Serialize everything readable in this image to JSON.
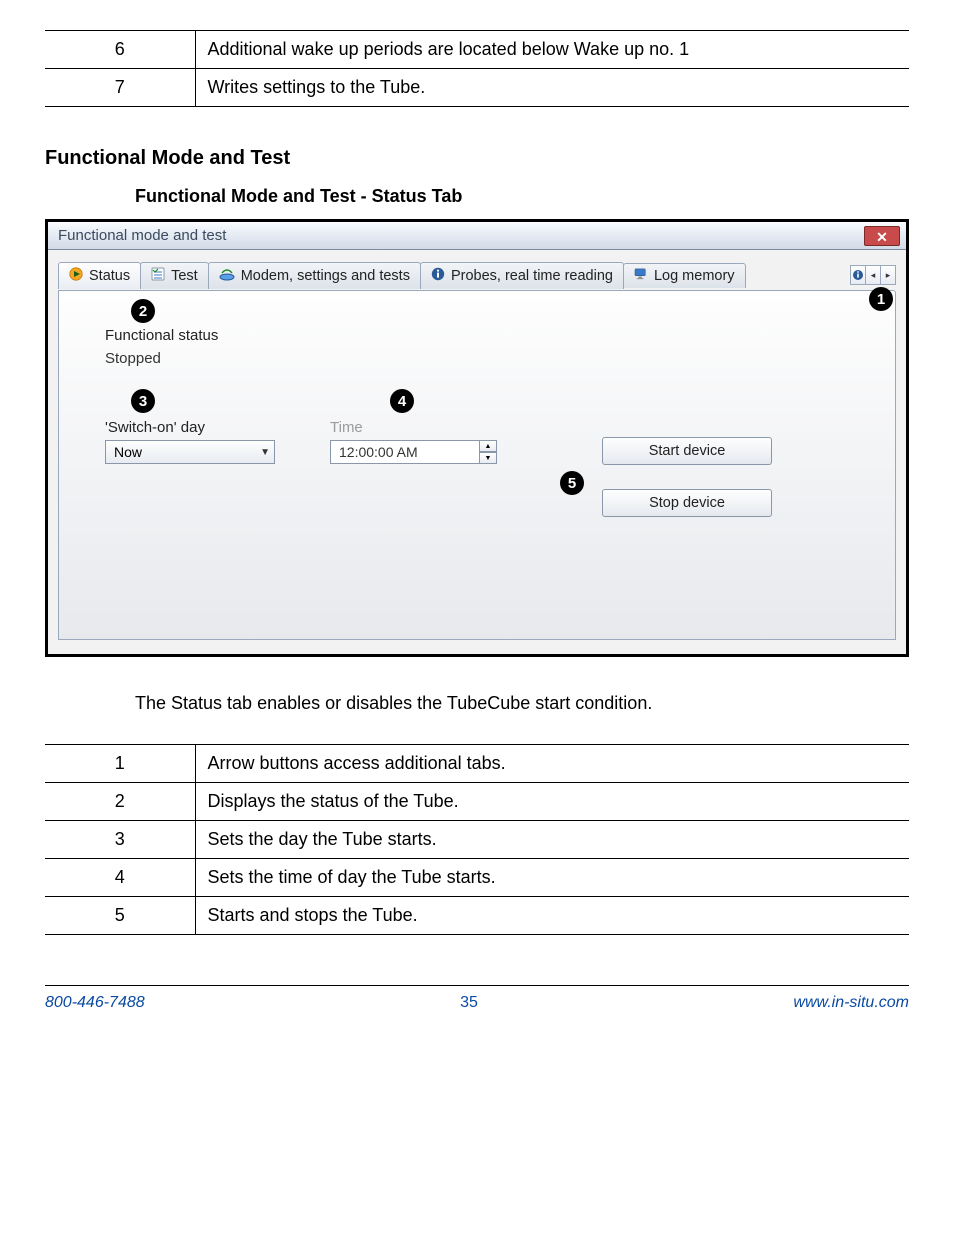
{
  "top_table": [
    {
      "num": "6",
      "text": "Additional wake up periods are located below Wake up no. 1"
    },
    {
      "num": "7",
      "text": "Writes settings to the Tube."
    }
  ],
  "section_title": "Functional Mode and Test",
  "subsection_title": "Functional Mode and Test - Status Tab",
  "window": {
    "title": "Functional mode and test",
    "tabs": [
      {
        "label": "Status"
      },
      {
        "label": "Test"
      },
      {
        "label": "Modem, settings and tests"
      },
      {
        "label": "Probes, real time reading"
      },
      {
        "label": "Log memory"
      }
    ],
    "functional_status_label": "Functional status",
    "functional_status_value": "Stopped",
    "switch_on_day_label": "'Switch-on' day",
    "switch_on_day_value": "Now",
    "time_label": "Time",
    "time_value": "12:00:00 AM",
    "start_button": "Start device",
    "stop_button": "Stop device"
  },
  "body_text": "The Status tab enables or disables the TubeCube start condition.",
  "bottom_table": [
    {
      "num": "1",
      "text": "Arrow buttons access additional tabs."
    },
    {
      "num": "2",
      "text": "Displays the status of the Tube."
    },
    {
      "num": "3",
      "text": "Sets the day the Tube starts."
    },
    {
      "num": "4",
      "text": "Sets the time of day the Tube starts."
    },
    {
      "num": "5",
      "text": "Starts and stops the Tube."
    }
  ],
  "footer": {
    "phone": "800-446-7488",
    "page": "35",
    "url": "www.in-situ.com"
  }
}
